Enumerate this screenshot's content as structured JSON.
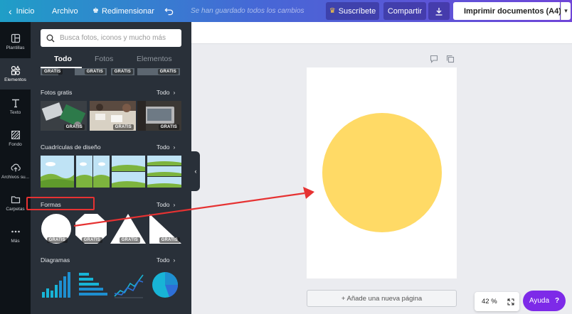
{
  "topbar": {
    "home_label": "Inicio",
    "file_label": "Archivo",
    "resize_label": "Redimensionar",
    "saved_status": "Se han guardado todos los cambios",
    "subscribe_label": "Suscríbete",
    "share_label": "Compartir",
    "print_label": "Imprimir documentos (A4)"
  },
  "sidebar": {
    "items": [
      {
        "label": "Plantillas",
        "icon": "templates-icon"
      },
      {
        "label": "Elementos",
        "icon": "elements-icon"
      },
      {
        "label": "Texto",
        "icon": "text-icon"
      },
      {
        "label": "Fondo",
        "icon": "background-icon"
      },
      {
        "label": "Archivos su...",
        "icon": "uploads-icon"
      },
      {
        "label": "Carpetas",
        "icon": "folder-icon"
      },
      {
        "label": "Más",
        "icon": "more-icon"
      }
    ]
  },
  "panel": {
    "search_placeholder": "Busca fotos, iconos y mucho más",
    "tabs": [
      {
        "label": "Todo"
      },
      {
        "label": "Fotos"
      },
      {
        "label": "Elementos"
      }
    ],
    "gratis_label": "GRATIS",
    "see_all_label": "Todo",
    "sections": {
      "photos": {
        "title": "Fotos gratis"
      },
      "grids": {
        "title": "Cuadrículas de diseño"
      },
      "shapes": {
        "title": "Formas"
      },
      "diagrams": {
        "title": "Diagramas"
      }
    }
  },
  "canvas": {
    "add_page_label": "+ Añade una nueva página",
    "zoom_label": "42 %",
    "help_label": "Ayuda",
    "help_symbol": "?",
    "shape_color": "#ffda66"
  },
  "colors": {
    "accent": "#7d2ae8",
    "highlight": "#e63232"
  }
}
